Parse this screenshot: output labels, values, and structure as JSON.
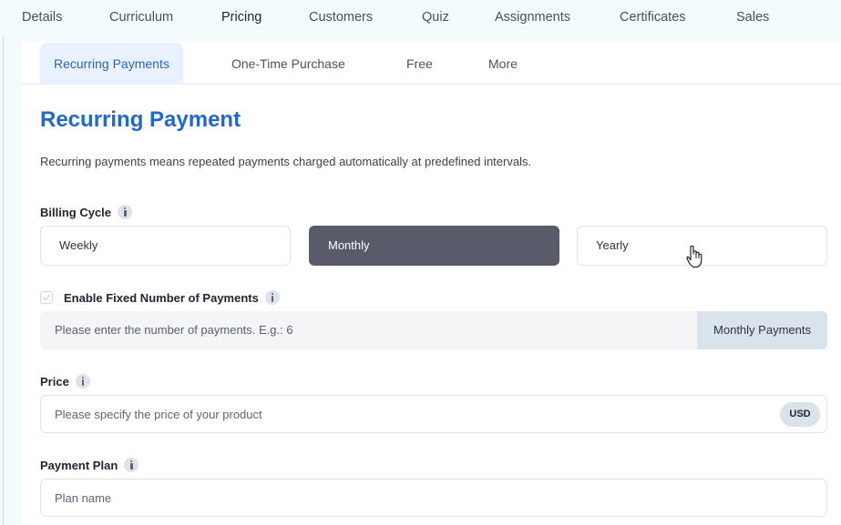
{
  "top_tabs": [
    {
      "label": "Details",
      "active": false
    },
    {
      "label": "Curriculum",
      "active": false
    },
    {
      "label": "Pricing",
      "active": true
    },
    {
      "label": "Customers",
      "active": false
    },
    {
      "label": "Quiz",
      "active": false
    },
    {
      "label": "Assignments",
      "active": false
    },
    {
      "label": "Certificates",
      "active": false
    },
    {
      "label": "Sales",
      "active": false
    }
  ],
  "pricing_tabs": [
    {
      "label": "Recurring Payments",
      "active": true
    },
    {
      "label": "One-Time Purchase",
      "active": false
    },
    {
      "label": "Free",
      "active": false
    },
    {
      "label": "More",
      "active": false
    }
  ],
  "section": {
    "title": "Recurring Payment",
    "description": "Recurring payments means repeated payments charged automatically at predefined intervals."
  },
  "billing_cycle": {
    "label": "Billing Cycle",
    "options": [
      "Weekly",
      "Monthly",
      "Yearly"
    ],
    "selected": "Monthly"
  },
  "fixed_payments": {
    "label": "Enable Fixed Number of Payments",
    "checked": false,
    "placeholder": "Please enter the number of payments. E.g.: 6",
    "addon": "Monthly Payments"
  },
  "price": {
    "label": "Price",
    "placeholder": "Please specify the price of your product",
    "currency": "USD"
  },
  "payment_plan": {
    "label": "Payment Plan",
    "placeholder": "Plan name"
  },
  "colors": {
    "accent": "#1f67d2",
    "active_tab_bg": "#e8f1fd",
    "selected_option_bg": "#595b6b",
    "addon_bg": "#d9e3eb"
  },
  "icons": {
    "info": "info-icon",
    "cursor": "hand-pointer-cursor-icon"
  }
}
